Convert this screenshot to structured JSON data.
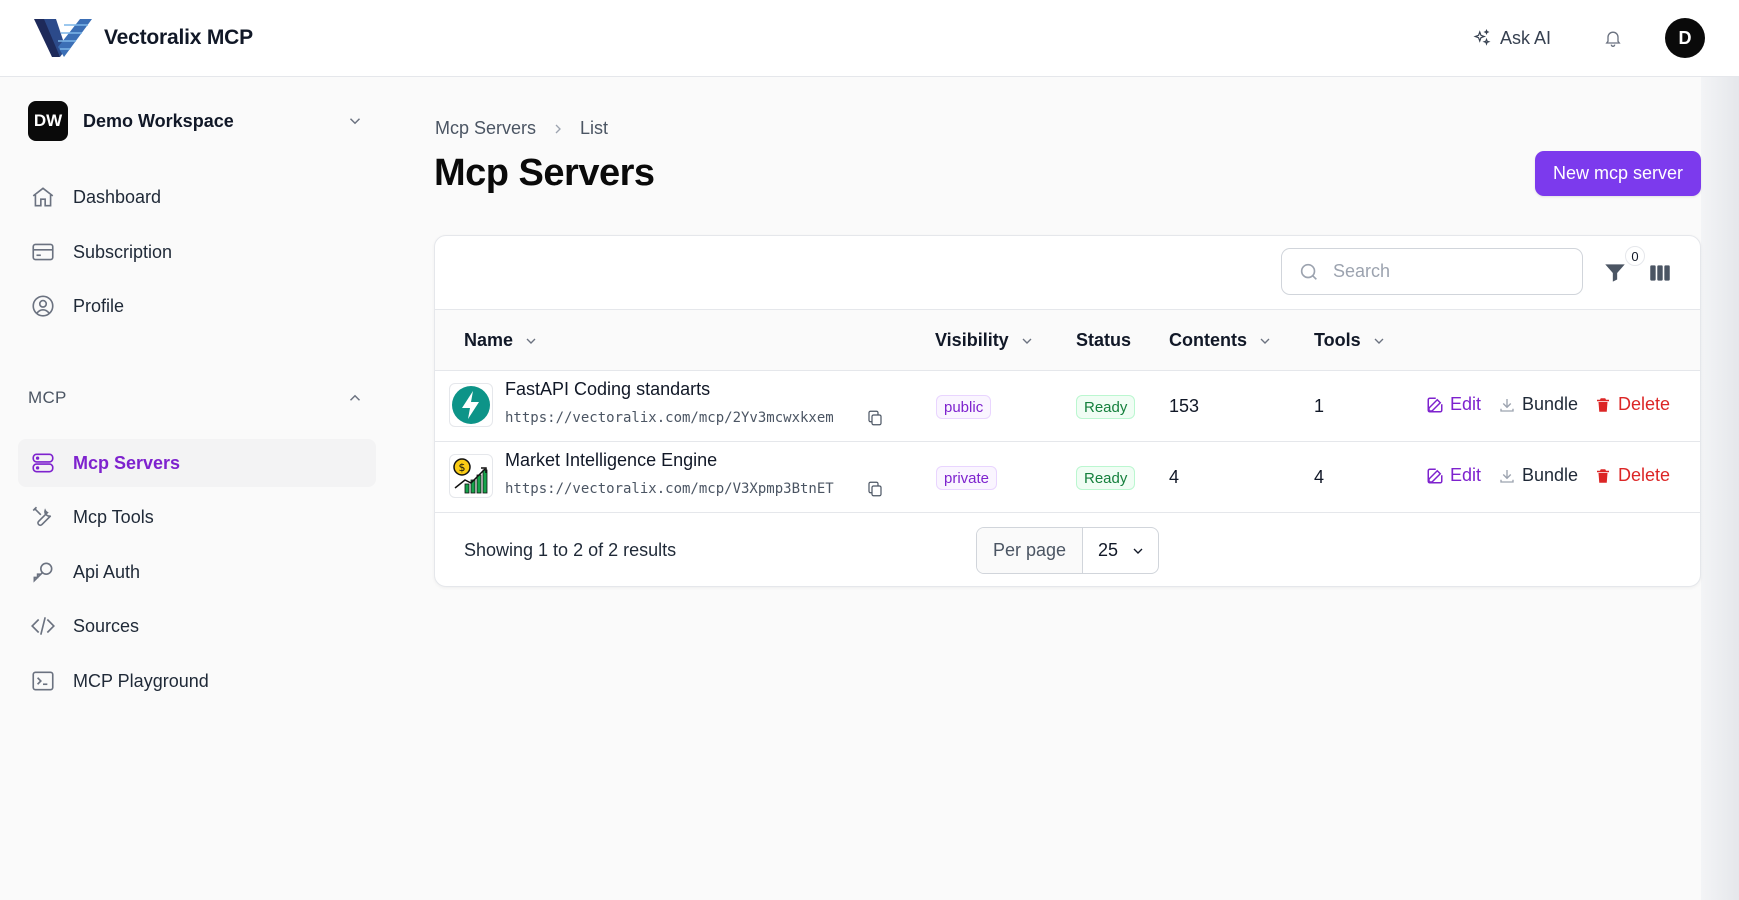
{
  "app": {
    "brand": "Vectoralix MCP"
  },
  "header": {
    "ask_ai_label": "Ask AI",
    "avatar_initial": "D"
  },
  "workspace": {
    "badge": "DW",
    "name": "Demo Workspace"
  },
  "sidebar": {
    "items": [
      {
        "label": "Dashboard",
        "icon": "home-icon"
      },
      {
        "label": "Subscription",
        "icon": "credit-card-icon"
      },
      {
        "label": "Profile",
        "icon": "user-circle-icon"
      }
    ],
    "mcp_section_label": "MCP",
    "mcp_items": [
      {
        "label": "Mcp Servers",
        "icon": "server-stack-icon",
        "active": true
      },
      {
        "label": "Mcp Tools",
        "icon": "wrench-screwdriver-icon"
      },
      {
        "label": "Api Auth",
        "icon": "key-icon"
      },
      {
        "label": "Sources",
        "icon": "code-bracket-icon"
      },
      {
        "label": "MCP Playground",
        "icon": "command-line-icon"
      }
    ]
  },
  "breadcrumb": {
    "parent": "Mcp Servers",
    "current": "List"
  },
  "page": {
    "title": "Mcp Servers",
    "new_button_label": "New mcp server"
  },
  "table": {
    "search_placeholder": "Search",
    "filter_count": "0",
    "columns": [
      "Name",
      "Visibility",
      "Status",
      "Contents",
      "Tools"
    ],
    "rows": [
      {
        "name": "FastAPI Coding standarts",
        "url": "https://vectoralix.com/mcp/2Yv3mcwxkxem",
        "visibility": "public",
        "status": "Ready",
        "contents": "153",
        "tools": "1",
        "icon": "lightning-bolt-icon"
      },
      {
        "name": "Market Intelligence Engine",
        "url": "https://vectoralix.com/mcp/V3Xpmp3BtnET",
        "visibility": "private",
        "status": "Ready",
        "contents": "4",
        "tools": "4",
        "icon": "growth-chart-icon"
      }
    ],
    "actions": {
      "edit": "Edit",
      "bundle": "Bundle",
      "delete": "Delete"
    },
    "results_text": "Showing 1 to 2 of 2 results",
    "per_page_label": "Per page",
    "per_page_value": "25"
  },
  "colors": {
    "accent": "#7c3aed",
    "accent_text": "#7e22ce",
    "danger": "#dc2626",
    "success": "#15803d"
  }
}
